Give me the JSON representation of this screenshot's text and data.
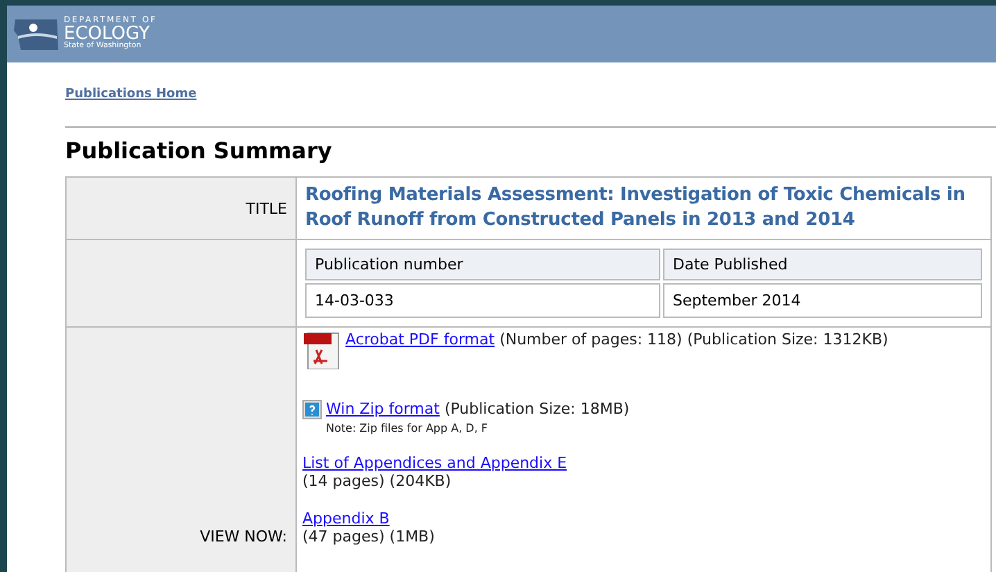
{
  "header": {
    "logo": {
      "line_1": "DEPARTMENT OF",
      "line_2": "ECOLOGY",
      "line_3": "State of Washington"
    }
  },
  "breadcrumb": "Publications Home",
  "heading": "Publication Summary",
  "summary": {
    "title_label": "TITLE",
    "title": "Roofing Materials Assessment: Investigation of Toxic Chemicals in Roof Runoff from Constructed Panels in 2013 and 2014",
    "details": {
      "columns": [
        "Publication number",
        "Date Published"
      ],
      "values": [
        "14-03-033",
        "September 2014"
      ]
    },
    "view_label": "VIEW NOW:",
    "downloads": [
      {
        "kind": "pdf",
        "link": "Acrobat PDF format",
        "info": "(Number of pages: 118) (Publication Size: 1312KB)"
      },
      {
        "kind": "zip",
        "link": "Win Zip format",
        "info": "(Publication Size: 18MB)",
        "note": "Note: Zip files for App A, D, F"
      },
      {
        "kind": "plain",
        "link": "List of Appendices and Appendix E",
        "info": "(14 pages) (204KB)"
      },
      {
        "kind": "plain",
        "link": "Appendix B",
        "info": "(47 pages) (1MB)"
      }
    ]
  }
}
